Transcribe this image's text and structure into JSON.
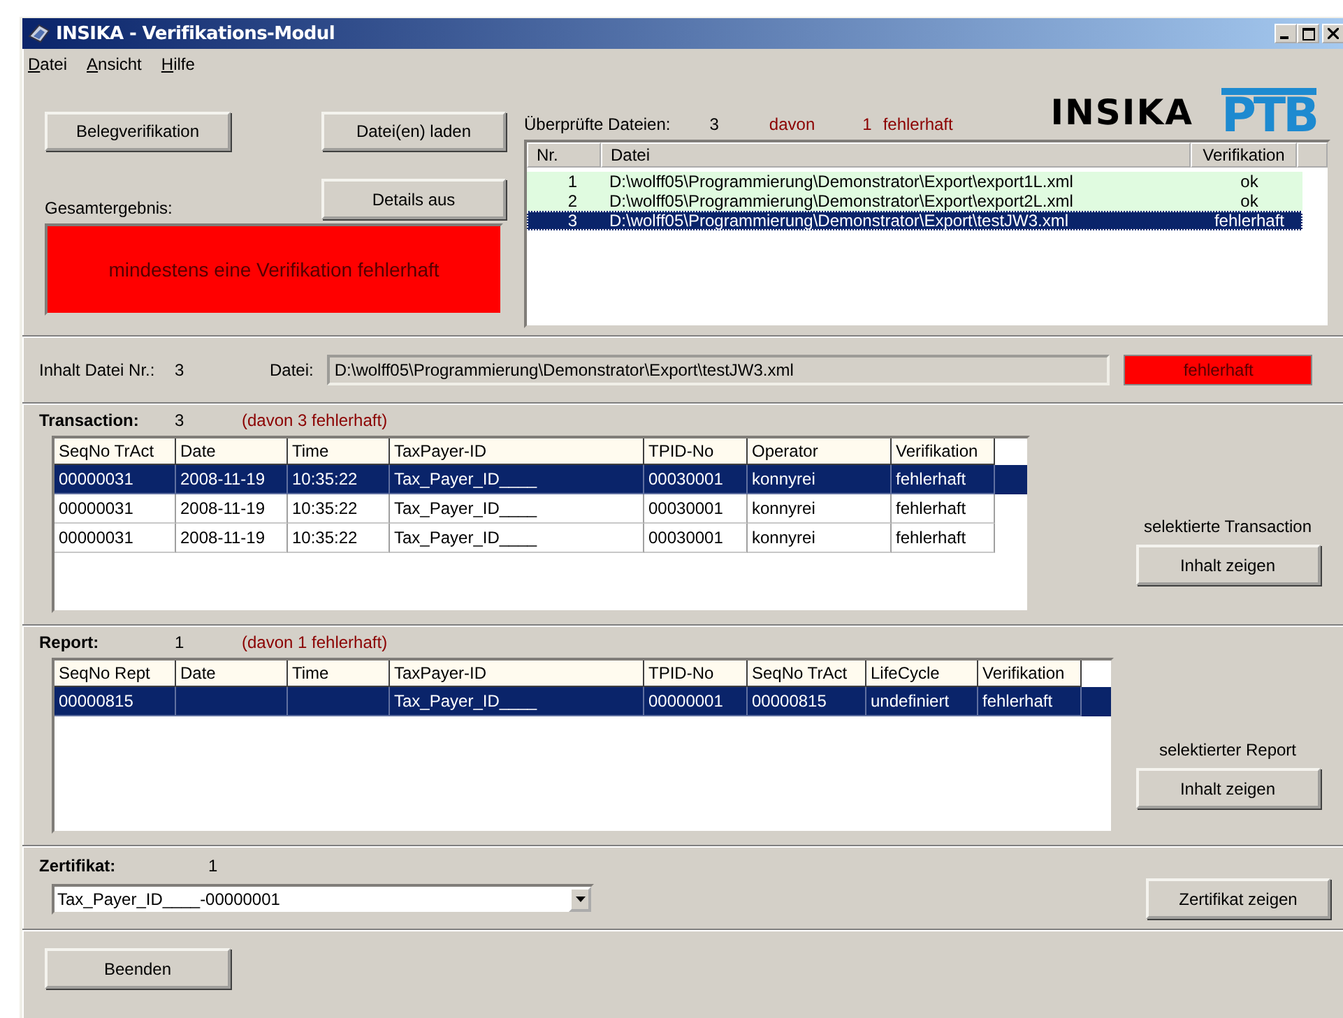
{
  "window": {
    "title": "INSIKA - Verifikations-Modul"
  },
  "menu": [
    "Datei",
    "Ansicht",
    "Hilfe"
  ],
  "buttons": {
    "verify": "Belegverifikation",
    "load": "Datei(en) laden",
    "details": "Details aus"
  },
  "overall": {
    "label": "Gesamtergebnis:",
    "result": "mindestens eine Verifikation fehlerhaft",
    "color": "#ff0000"
  },
  "checked_files": {
    "label": "Überprüfte Dateien:",
    "count": "3",
    "of_label": "davon",
    "error_count": "1",
    "error_label": "fehlerhaft"
  },
  "logos": {
    "insika": "INSIKA",
    "ptb": "PTB"
  },
  "files": {
    "columns": [
      "Nr.",
      "Datei",
      "Verifikation"
    ],
    "rows": [
      {
        "nr": "1",
        "path": "D:\\wolff05\\Programmierung\\Demonstrator\\Export\\export1L.xml",
        "verification": "ok",
        "color": "#e0fbe0",
        "selected": false
      },
      {
        "nr": "2",
        "path": "D:\\wolff05\\Programmierung\\Demonstrator\\Export\\export2L.xml",
        "verification": "ok",
        "color": "#e0fbe0",
        "selected": false
      },
      {
        "nr": "3",
        "path": "D:\\wolff05\\Programmierung\\Demonstrator\\Export\\testJW3.xml",
        "verification": "fehlerhaft",
        "selected": true
      }
    ]
  },
  "content": {
    "label": "Inhalt Datei Nr.:",
    "number": "3",
    "file_label": "Datei:",
    "path": "D:\\wolff05\\Programmierung\\Demonstrator\\Export\\testJW3.xml",
    "result": "fehlerhaft",
    "color": "#ff0000"
  },
  "transactions": {
    "title": "Transaction:",
    "count": "3",
    "errors": "(davon 3 fehlerhaft)",
    "columns": [
      "SeqNo TrAct",
      "Date",
      "Time",
      "TaxPayer-ID",
      "TPID-No",
      "Operator",
      "Verifikation"
    ],
    "rows": [
      {
        "cells": [
          "00000031",
          "2008-11-19",
          "10:35:22",
          "Tax_Payer_ID____",
          "00030001",
          "konnyrei",
          "fehlerhaft"
        ],
        "selected": true
      },
      {
        "cells": [
          "00000031",
          "2008-11-19",
          "10:35:22",
          "Tax_Payer_ID____",
          "00030001",
          "konnyrei",
          "fehlerhaft"
        ],
        "selected": false
      },
      {
        "cells": [
          "00000031",
          "2008-11-19",
          "10:35:22",
          "Tax_Payer_ID____",
          "00030001",
          "konnyrei",
          "fehlerhaft"
        ],
        "selected": false
      }
    ],
    "side_label": "selektierte Transaction",
    "button": "Inhalt zeigen"
  },
  "reports": {
    "title": "Report:",
    "count": "1",
    "errors": "(davon 1 fehlerhaft)",
    "columns": [
      "SeqNo Rept",
      "Date",
      "Time",
      "TaxPayer-ID",
      "TPID-No",
      "SeqNo TrAct",
      "LifeCycle",
      "Verifikation"
    ],
    "rows": [
      {
        "cells": [
          "00000815",
          null,
          null,
          "Tax_Payer_ID____",
          "00000001",
          "00000815",
          "undefiniert",
          "fehlerhaft"
        ],
        "selected": true
      }
    ],
    "side_label": "selektierter Report",
    "button": "Inhalt zeigen"
  },
  "certificate": {
    "title": "Zertifikat:",
    "count": "1",
    "value": "Tax_Payer_ID____-00000001",
    "button": "Zertifikat zeigen"
  },
  "exit_button": "Beenden"
}
